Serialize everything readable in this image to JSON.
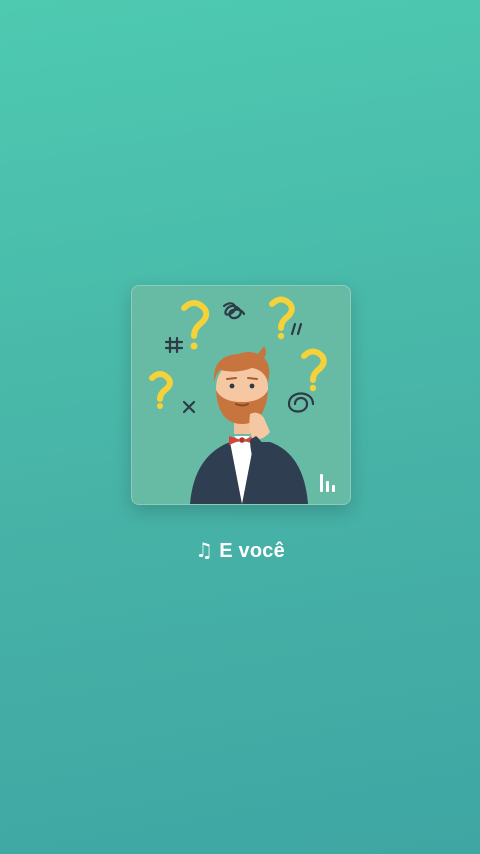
{
  "track": {
    "title": "E você",
    "note_icon": "music-note-icon",
    "now_playing_icon": "equalizer-bars-icon"
  },
  "colors": {
    "background_top": "#4ecab1",
    "background_bottom": "#3fa6a3",
    "card_background": "#67bba4",
    "question_mark": "#f5d13a",
    "text": "#ffffff"
  }
}
